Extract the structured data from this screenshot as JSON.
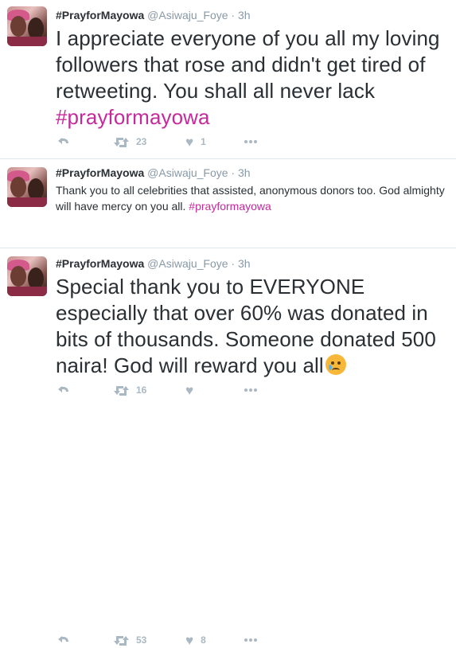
{
  "tweets": [
    {
      "fullname": "#PrayforMayowa",
      "username": "@Asiwaju_Foye",
      "time": "3h",
      "text": "I appreciate everyone of you all my loving followers that rose and didn't get tired of retweeting. You shall all never lack ",
      "hashtag": "#prayformayowa",
      "retweets": "23",
      "likes": "1"
    },
    {
      "fullname": "#PrayforMayowa",
      "username": "@Asiwaju_Foye",
      "time": "3h",
      "text": "Thank you to all celebrities that assisted, anonymous donors too. God almighty will have mercy on you all. ",
      "hashtag": "#prayformayowa",
      "retweets": "16",
      "likes": ""
    },
    {
      "fullname": "#PrayforMayowa",
      "username": "@Asiwaju_Foye",
      "time": "3h",
      "text": "Special thank you to EVERYONE especially that over 60% was donated in bits of thousands. Someone donated 500 naira! God will reward you all",
      "emoji": "crying-face-emoji",
      "retweets": "53",
      "likes": "8"
    }
  ],
  "separator": "·",
  "icons": {
    "reply": "reply-icon",
    "retweet": "retweet-icon",
    "like": "heart-icon",
    "more": "more-dots-icon"
  },
  "colors": {
    "hashtag": "#c52a9b",
    "muted": "#8899a6",
    "icon": "#aab8c2",
    "text": "#292f33",
    "divider": "#e1e8ed"
  }
}
